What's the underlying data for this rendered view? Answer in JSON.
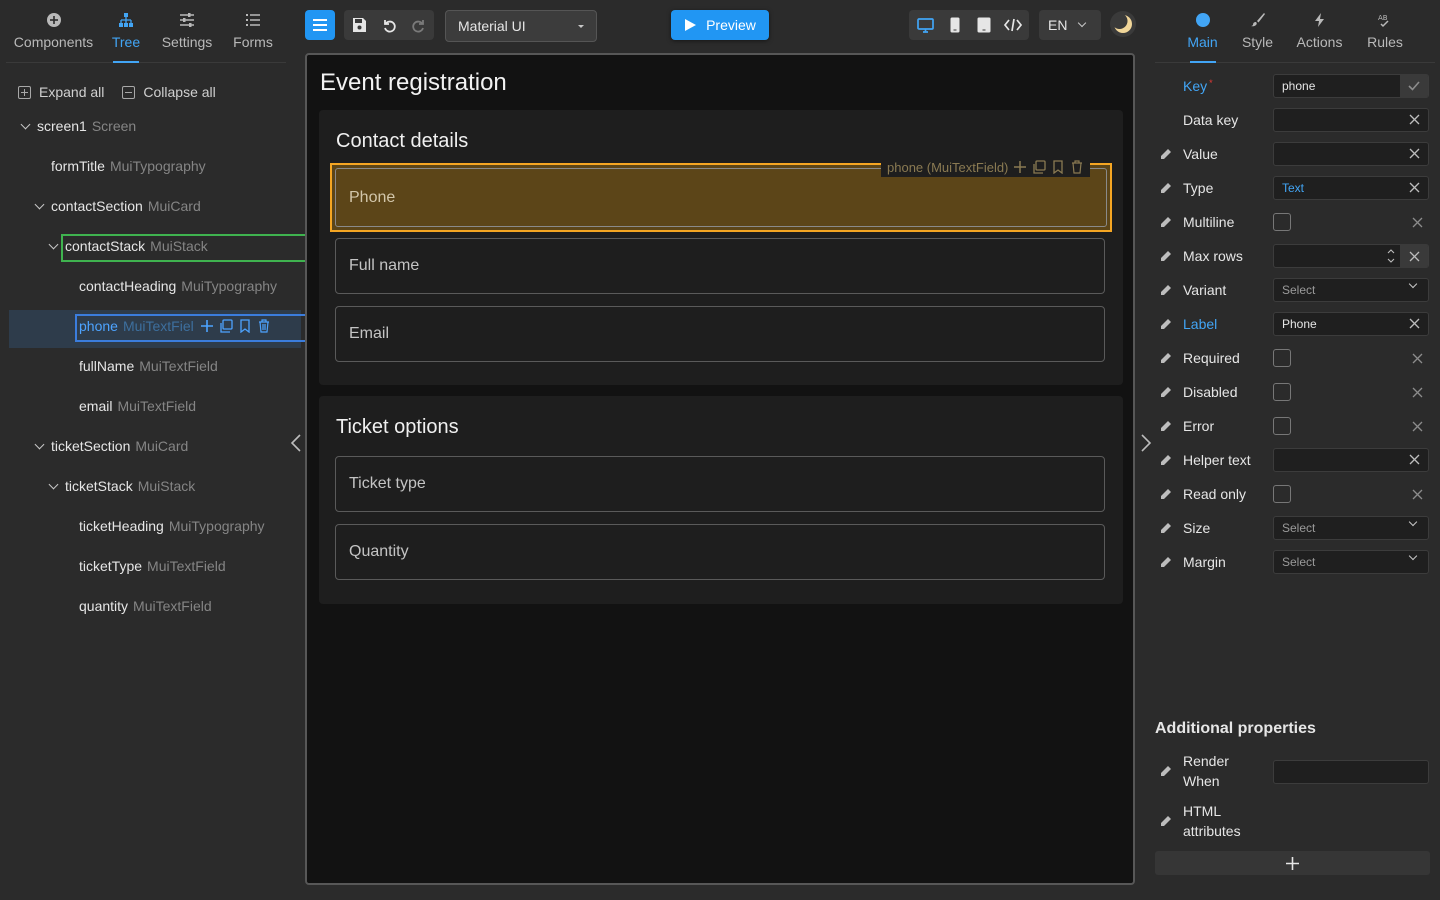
{
  "left_tabs": [
    {
      "label": "Components",
      "icon": "plus-circle-icon"
    },
    {
      "label": "Tree",
      "icon": "tree-icon",
      "active": true
    },
    {
      "label": "Settings",
      "icon": "sliders-icon"
    },
    {
      "label": "Forms",
      "icon": "list-icon"
    }
  ],
  "tree": {
    "expand_all": "Expand all",
    "collapse_all": "Collapse all",
    "items": [
      {
        "name": "screen1",
        "type": "Screen"
      },
      {
        "name": "formTitle",
        "type": "MuiTypography"
      },
      {
        "name": "contactSection",
        "type": "MuiCard"
      },
      {
        "name": "contactStack",
        "type": "MuiStack"
      },
      {
        "name": "contactHeading",
        "type": "MuiTypography"
      },
      {
        "name": "phone",
        "type": "MuiTextFiel"
      },
      {
        "name": "fullName",
        "type": "MuiTextField"
      },
      {
        "name": "email",
        "type": "MuiTextField"
      },
      {
        "name": "ticketSection",
        "type": "MuiCard"
      },
      {
        "name": "ticketStack",
        "type": "MuiStack"
      },
      {
        "name": "ticketHeading",
        "type": "MuiTypography"
      },
      {
        "name": "ticketType",
        "type": "MuiTextField"
      },
      {
        "name": "quantity",
        "type": "MuiTextField"
      }
    ]
  },
  "toolbar": {
    "library": "Material UI",
    "preview_label": "Preview",
    "language": "EN"
  },
  "canvas": {
    "form_title": "Event registration",
    "contact_card": {
      "heading": "Contact details",
      "fields": [
        "Phone",
        "Full name",
        "Email"
      ],
      "selected_tag": "phone (MuiTextField)"
    },
    "ticket_card": {
      "heading": "Ticket options",
      "fields": [
        "Ticket type",
        "Quantity"
      ]
    }
  },
  "right_tabs": [
    {
      "label": "Main",
      "icon": "circle-icon",
      "active": true
    },
    {
      "label": "Style",
      "icon": "brush-icon"
    },
    {
      "label": "Actions",
      "icon": "bolt-icon"
    },
    {
      "label": "Rules",
      "icon": "rules-icon"
    }
  ],
  "properties": {
    "key": {
      "label": "Key",
      "value": "phone"
    },
    "data_key": {
      "label": "Data key",
      "value": ""
    },
    "value": {
      "label": "Value",
      "value": ""
    },
    "type": {
      "label": "Type",
      "value": "Text"
    },
    "multiline": {
      "label": "Multiline"
    },
    "max_rows": {
      "label": "Max rows",
      "value": ""
    },
    "variant": {
      "label": "Variant",
      "placeholder": "Select"
    },
    "label": {
      "label": "Label",
      "value": "Phone"
    },
    "required": {
      "label": "Required"
    },
    "disabled": {
      "label": "Disabled"
    },
    "error": {
      "label": "Error"
    },
    "helper_text": {
      "label": "Helper text",
      "value": ""
    },
    "read_only": {
      "label": "Read only"
    },
    "size": {
      "label": "Size",
      "placeholder": "Select"
    },
    "margin": {
      "label": "Margin",
      "placeholder": "Select"
    }
  },
  "additional": {
    "title": "Additional properties",
    "render_when_line1": "Render",
    "render_when_line2": "When",
    "html_attr_line1": "HTML",
    "html_attr_line2": "attributes"
  },
  "colors": {
    "accent": "#2196f3",
    "selection_orange": "#f5a623",
    "selection_green": "#3fb34f",
    "selection_blue": "#3b7ddd"
  }
}
